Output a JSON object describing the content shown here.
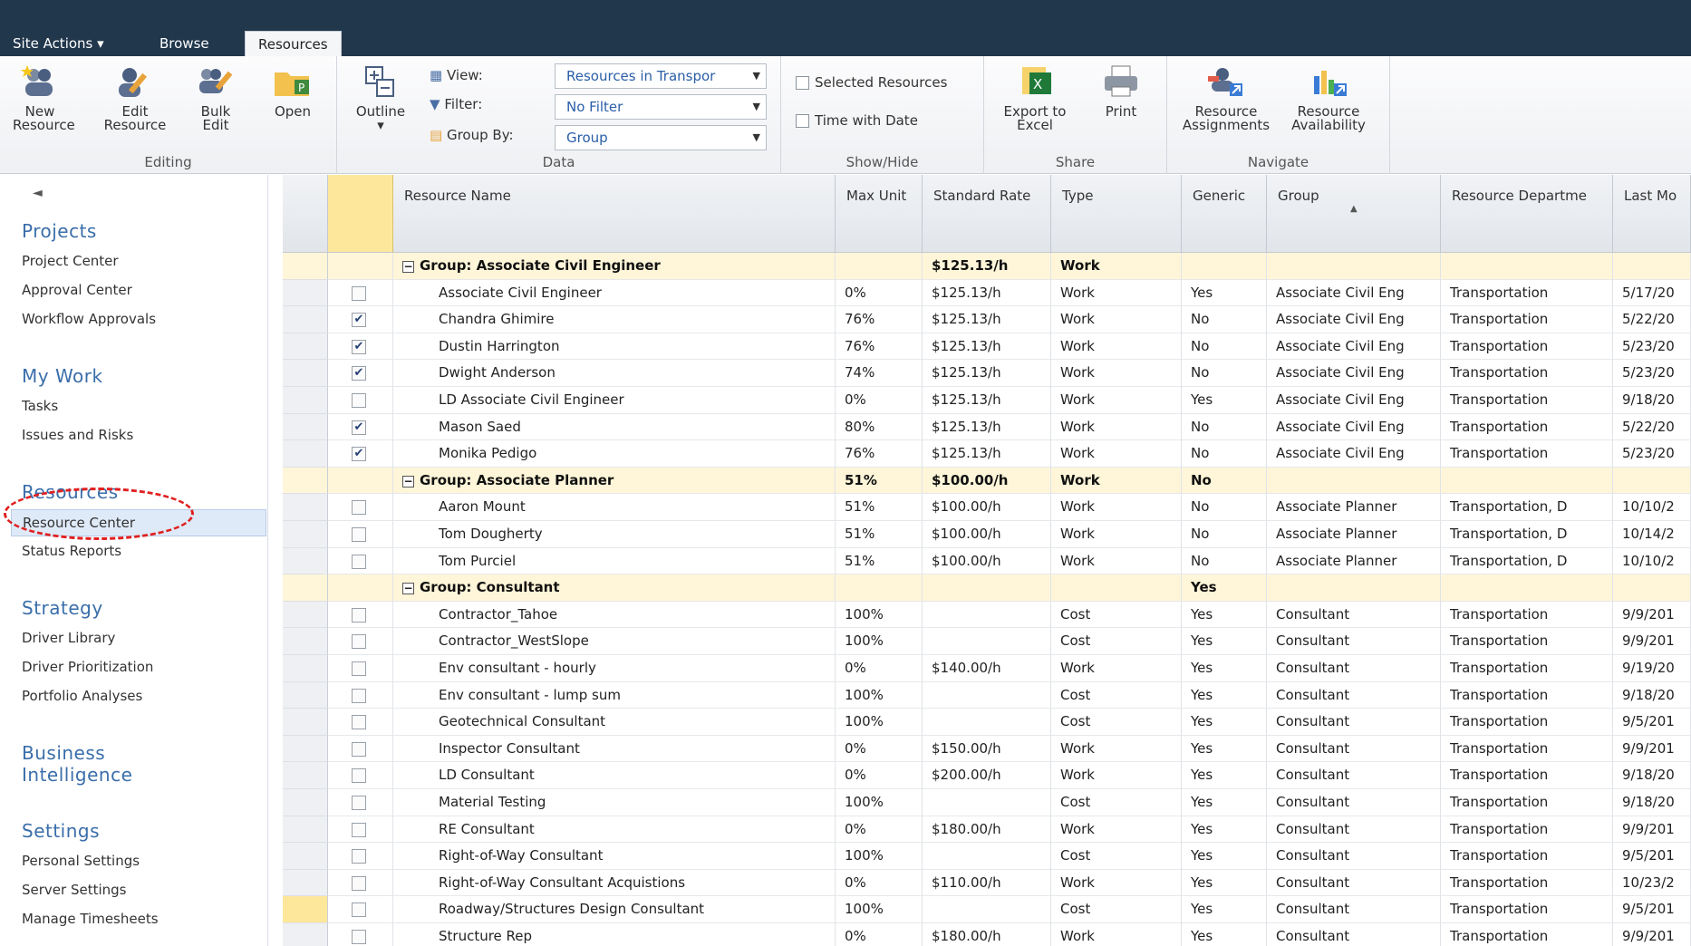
{
  "tabs": [
    "Site Actions ▾",
    "Browse",
    "Resources"
  ],
  "ribbon": {
    "editing": {
      "label": "Editing",
      "buttons": [
        {
          "line1": "New",
          "line2": "Resource"
        },
        {
          "line1": "Edit",
          "line2": "Resource"
        },
        {
          "line1": "Bulk",
          "line2": "Edit"
        },
        {
          "line1": "Open",
          "line2": ""
        }
      ]
    },
    "data": {
      "label": "Data",
      "outline": "Outline",
      "view_label": "View:",
      "view_value": "Resources in Transpor",
      "filter_label": "Filter:",
      "filter_value": "No Filter",
      "groupby_label": "Group By:",
      "groupby_value": "Group"
    },
    "showhide": {
      "label": "Show/Hide",
      "selected_resources": "Selected Resources",
      "time_with_date": "Time with Date"
    },
    "share": {
      "label": "Share",
      "export_line1": "Export to",
      "export_line2": "Excel",
      "print": "Print"
    },
    "navigate": {
      "label": "Navigate",
      "assign_line1": "Resource",
      "assign_line2": "Assignments",
      "avail_line1": "Resource",
      "avail_line2": "Availability"
    }
  },
  "nav": {
    "collapse": "◄",
    "projects": "Projects",
    "project_center": "Project Center",
    "approval_center": "Approval Center",
    "workflow_approvals": "Workflow Approvals",
    "my_work": "My Work",
    "tasks": "Tasks",
    "issues_risks": "Issues and Risks",
    "resources": "Resources",
    "resource_center": "Resource Center",
    "status_reports": "Status Reports",
    "strategy": "Strategy",
    "driver_library": "Driver Library",
    "driver_prioritization": "Driver Prioritization",
    "portfolio_analyses": "Portfolio Analyses",
    "bi_line1": "Business",
    "bi_line2": "Intelligence",
    "settings": "Settings",
    "personal_settings": "Personal Settings",
    "server_settings": "Server Settings",
    "manage_timesheets": "Manage Timesheets"
  },
  "grid": {
    "columns": [
      "Resource Name",
      "Max Unit",
      "Standard Rate",
      "Type",
      "Generic",
      "Group",
      "Resource Departme",
      "Last Mo"
    ],
    "sort_indicator": "▲",
    "rows": [
      {
        "kind": "group",
        "name": "Group: Associate Civil Engineer",
        "max": "",
        "rate": "$125.13/h",
        "type": "Work",
        "generic": "",
        "group": "",
        "dept": "",
        "last": ""
      },
      {
        "kind": "item",
        "checked": false,
        "name": "Associate Civil Engineer",
        "max": "0%",
        "rate": "$125.13/h",
        "type": "Work",
        "generic": "Yes",
        "group": "Associate Civil Eng",
        "dept": "Transportation",
        "last": "5/17/20"
      },
      {
        "kind": "item",
        "checked": true,
        "name": "Chandra Ghimire",
        "max": "76%",
        "rate": "$125.13/h",
        "type": "Work",
        "generic": "No",
        "group": "Associate Civil Eng",
        "dept": "Transportation",
        "last": "5/22/20"
      },
      {
        "kind": "item",
        "checked": true,
        "name": "Dustin Harrington",
        "max": "76%",
        "rate": "$125.13/h",
        "type": "Work",
        "generic": "No",
        "group": "Associate Civil Eng",
        "dept": "Transportation",
        "last": "5/23/20"
      },
      {
        "kind": "item",
        "checked": true,
        "name": "Dwight Anderson",
        "max": "74%",
        "rate": "$125.13/h",
        "type": "Work",
        "generic": "No",
        "group": "Associate Civil Eng",
        "dept": "Transportation",
        "last": "5/23/20"
      },
      {
        "kind": "item",
        "checked": false,
        "name": "LD Associate Civil Engineer",
        "max": "0%",
        "rate": "$125.13/h",
        "type": "Work",
        "generic": "Yes",
        "group": "Associate Civil Eng",
        "dept": "Transportation",
        "last": "9/18/20"
      },
      {
        "kind": "item",
        "checked": true,
        "name": "Mason Saed",
        "max": "80%",
        "rate": "$125.13/h",
        "type": "Work",
        "generic": "No",
        "group": "Associate Civil Eng",
        "dept": "Transportation",
        "last": "5/22/20"
      },
      {
        "kind": "item",
        "checked": true,
        "name": "Monika Pedigo",
        "max": "76%",
        "rate": "$125.13/h",
        "type": "Work",
        "generic": "No",
        "group": "Associate Civil Eng",
        "dept": "Transportation",
        "last": "5/23/20"
      },
      {
        "kind": "group",
        "name": "Group: Associate Planner",
        "max": "51%",
        "rate": "$100.00/h",
        "type": "Work",
        "generic": "No",
        "group": "",
        "dept": "",
        "last": ""
      },
      {
        "kind": "item",
        "checked": false,
        "name": "Aaron Mount",
        "max": "51%",
        "rate": "$100.00/h",
        "type": "Work",
        "generic": "No",
        "group": "Associate Planner",
        "dept": "Transportation, D",
        "last": "10/10/2"
      },
      {
        "kind": "item",
        "checked": false,
        "name": "Tom Dougherty",
        "max": "51%",
        "rate": "$100.00/h",
        "type": "Work",
        "generic": "No",
        "group": "Associate Planner",
        "dept": "Transportation, D",
        "last": "10/14/2"
      },
      {
        "kind": "item",
        "checked": false,
        "name": "Tom Purciel",
        "max": "51%",
        "rate": "$100.00/h",
        "type": "Work",
        "generic": "No",
        "group": "Associate Planner",
        "dept": "Transportation, D",
        "last": "10/10/2"
      },
      {
        "kind": "group",
        "name": "Group: Consultant",
        "max": "",
        "rate": "",
        "type": "",
        "generic": "Yes",
        "group": "",
        "dept": "",
        "last": ""
      },
      {
        "kind": "item",
        "checked": false,
        "name": "Contractor_Tahoe",
        "max": "100%",
        "rate": "",
        "type": "Cost",
        "generic": "Yes",
        "group": "Consultant",
        "dept": "Transportation",
        "last": "9/9/201"
      },
      {
        "kind": "item",
        "checked": false,
        "name": "Contractor_WestSlope",
        "max": "100%",
        "rate": "",
        "type": "Cost",
        "generic": "Yes",
        "group": "Consultant",
        "dept": "Transportation",
        "last": "9/9/201"
      },
      {
        "kind": "item",
        "checked": false,
        "name": "Env consultant - hourly",
        "max": "0%",
        "rate": "$140.00/h",
        "type": "Work",
        "generic": "Yes",
        "group": "Consultant",
        "dept": "Transportation",
        "last": "9/19/20"
      },
      {
        "kind": "item",
        "checked": false,
        "name": "Env consultant - lump sum",
        "max": "100%",
        "rate": "",
        "type": "Cost",
        "generic": "Yes",
        "group": "Consultant",
        "dept": "Transportation",
        "last": "9/18/20"
      },
      {
        "kind": "item",
        "checked": false,
        "name": "Geotechnical Consultant",
        "max": "100%",
        "rate": "",
        "type": "Cost",
        "generic": "Yes",
        "group": "Consultant",
        "dept": "Transportation",
        "last": "9/5/201"
      },
      {
        "kind": "item",
        "checked": false,
        "name": "Inspector Consultant",
        "max": "0%",
        "rate": "$150.00/h",
        "type": "Work",
        "generic": "Yes",
        "group": "Consultant",
        "dept": "Transportation",
        "last": "9/9/201"
      },
      {
        "kind": "item",
        "checked": false,
        "name": "LD Consultant",
        "max": "0%",
        "rate": "$200.00/h",
        "type": "Work",
        "generic": "Yes",
        "group": "Consultant",
        "dept": "Transportation",
        "last": "9/18/20"
      },
      {
        "kind": "item",
        "checked": false,
        "name": "Material Testing",
        "max": "100%",
        "rate": "",
        "type": "Cost",
        "generic": "Yes",
        "group": "Consultant",
        "dept": "Transportation",
        "last": "9/18/20"
      },
      {
        "kind": "item",
        "checked": false,
        "name": "RE Consultant",
        "max": "0%",
        "rate": "$180.00/h",
        "type": "Work",
        "generic": "Yes",
        "group": "Consultant",
        "dept": "Transportation",
        "last": "9/9/201"
      },
      {
        "kind": "item",
        "checked": false,
        "name": "Right-of-Way Consultant",
        "max": "100%",
        "rate": "",
        "type": "Cost",
        "generic": "Yes",
        "group": "Consultant",
        "dept": "Transportation",
        "last": "9/5/201"
      },
      {
        "kind": "item",
        "checked": false,
        "name": "Right-of-Way Consultant Acquistions",
        "max": "0%",
        "rate": "$110.00/h",
        "type": "Work",
        "generic": "Yes",
        "group": "Consultant",
        "dept": "Transportation",
        "last": "10/23/2"
      },
      {
        "kind": "item",
        "checked": false,
        "selected": true,
        "name": "Roadway/Structures Design Consultant",
        "max": "100%",
        "rate": "",
        "type": "Cost",
        "generic": "Yes",
        "group": "Consultant",
        "dept": "Transportation",
        "last": "9/5/201"
      },
      {
        "kind": "item",
        "checked": false,
        "name": "Structure Rep",
        "max": "0%",
        "rate": "$180.00/h",
        "type": "Work",
        "generic": "Yes",
        "group": "Consultant",
        "dept": "Transportation",
        "last": "9/9/201"
      }
    ]
  },
  "colors": {
    "topbar": "#21374c",
    "group_row": "#fff6d9",
    "selected": "#fde79a",
    "link": "#3a6eaa",
    "annotation": "#e02020"
  }
}
